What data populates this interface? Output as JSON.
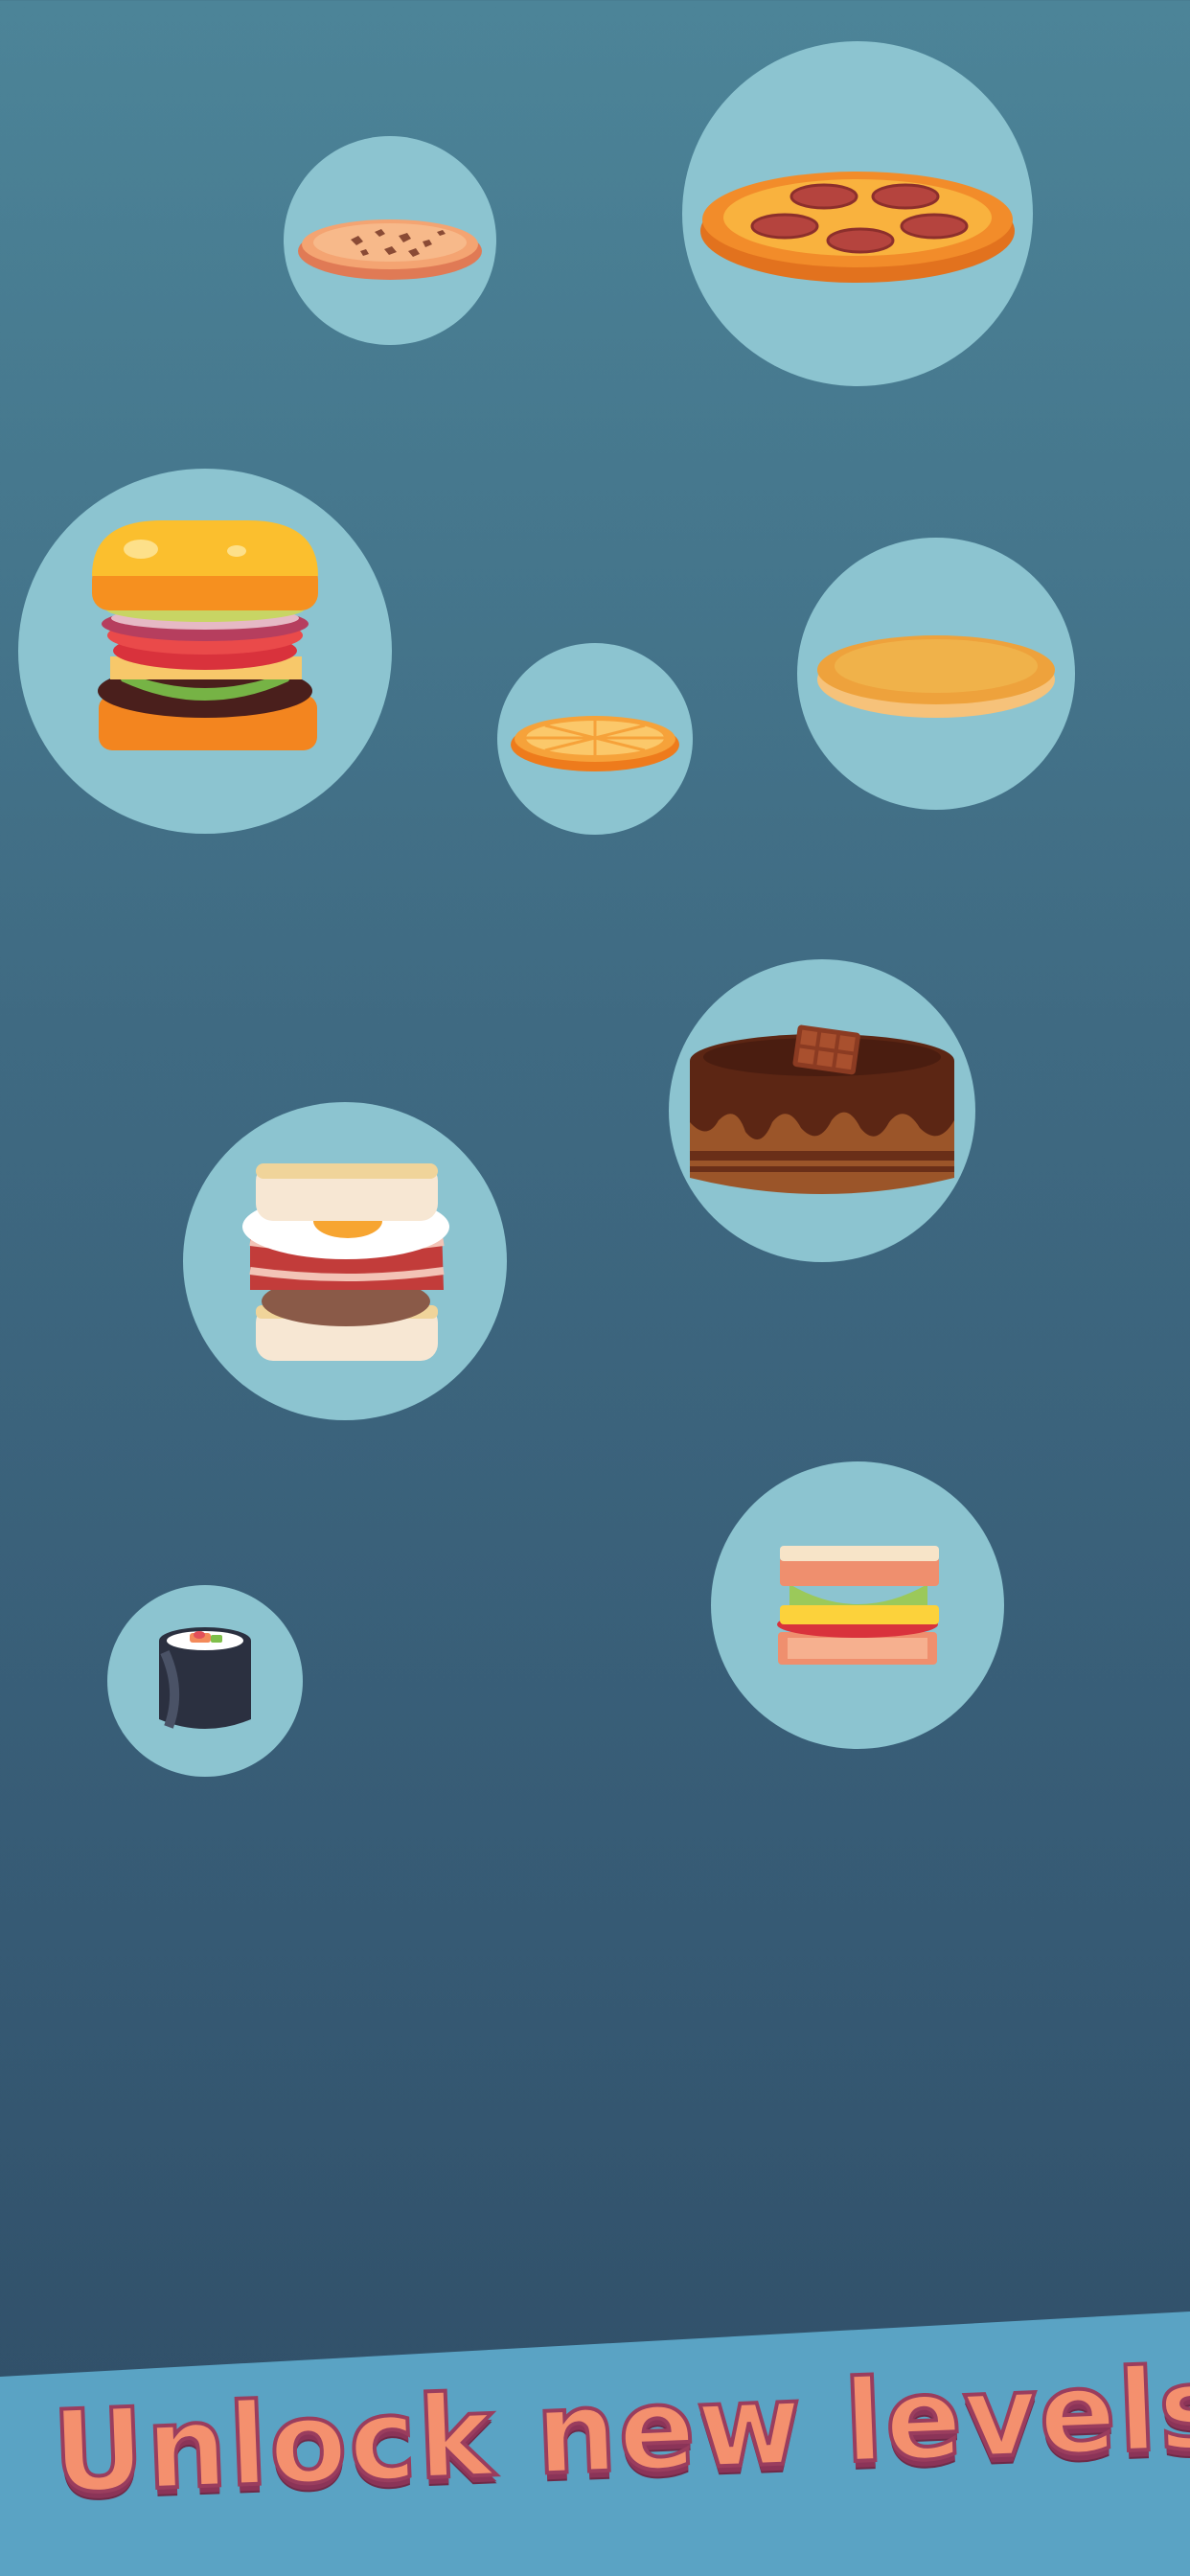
{
  "banner": {
    "title": "Unlock new levels",
    "background_color": "#5aa3c4",
    "text_fill": "#f4906e",
    "text_stroke": "#9a3d5e"
  },
  "bubble_color": "#8cc4d0",
  "foods": [
    {
      "name": "cookie-pizza-icon"
    },
    {
      "name": "pepperoni-pizza-icon"
    },
    {
      "name": "burger-icon"
    },
    {
      "name": "orange-slice-icon"
    },
    {
      "name": "pancake-icon"
    },
    {
      "name": "chocolate-cake-icon"
    },
    {
      "name": "breakfast-sandwich-icon"
    },
    {
      "name": "club-sandwich-icon"
    },
    {
      "name": "sushi-roll-icon"
    }
  ]
}
